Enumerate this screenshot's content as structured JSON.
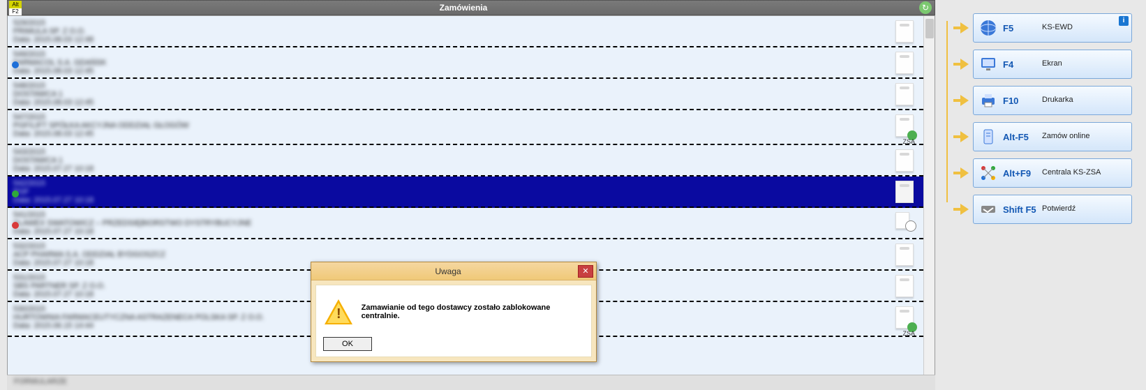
{
  "titlebar": {
    "alt_label": "Alt",
    "f2_label": "F2",
    "title": "Zamówienia"
  },
  "rows": [
    {
      "l1": "529/2015",
      "l2": "PRIMULA SP. Z O.O.",
      "l3": "Data: 2015.08.03 12:48",
      "icon": "doc"
    },
    {
      "l1": "549/2015",
      "l2": "FARMACOL S.A. GDAŃSK",
      "l3": "Data: 2015.08.03 12:45",
      "icon": "doc",
      "dot": "#1e6fd8"
    },
    {
      "l1": "548/2015",
      "l2": "DOSTAWCA 1",
      "l3": "Data: 2015.08.03 12:45",
      "icon": "doc"
    },
    {
      "l1": "547/2015",
      "l2": "PGF/LIFT SPÓŁKA AKCYJNA ODDZIAŁ GŁOGÓW",
      "l3": "Data: 2015.08.03 12:45",
      "icon": "zsa",
      "zsa": "ZSA"
    },
    {
      "l1": "543/2015",
      "l2": "DOSTAWCA 1",
      "l3": "Data: 2015.07.27 10:18",
      "icon": "doc"
    },
    {
      "l1": "542/2015",
      "l2": "PGF",
      "l3": "Data: 2015.07.27 10:18",
      "icon": "doc",
      "selected": true,
      "dot": "#2eaa3a"
    },
    {
      "l1": "541/2015",
      "l2": "SLAWEX SWATOWICZ – PRZEDSIĘBIORSTWO DYSTRYBUCYJNE",
      "l3": "Data: 2015.07.27 10:18",
      "icon": "clock",
      "dot": "#d83a3a"
    },
    {
      "l1": "532/2015",
      "l2": "ACP PHARMA S.A. ODDZIAŁ BYDGOSZCZ",
      "l3": "Data: 2015.07.27 10:18",
      "icon": "doc"
    },
    {
      "l1": "531/2015",
      "l2": "SBS PARTNER SP. Z O.O.",
      "l3": "Data: 2015.07.27 10:18",
      "icon": "doc"
    },
    {
      "l1": "530/2015",
      "l2": "HURTOWNIA FARMACEUTYCZNA ASTRAZENECA POLSKA SP. Z O.O.",
      "l3": "Data: 2015.06.15 14:44",
      "icon": "zsa",
      "zsa": "ZSA"
    }
  ],
  "bottom_strip": "FORMULARZE",
  "sidebar": {
    "buttons": [
      {
        "key": "F5",
        "label": "KS-EWD",
        "icon": "globe",
        "info": "i"
      },
      {
        "key": "F4",
        "label": "Ekran",
        "icon": "monitor"
      },
      {
        "key": "F10",
        "label": "Drukarka",
        "icon": "printer"
      },
      {
        "key": "Alt-F5",
        "label": "Zamów online",
        "icon": "online"
      },
      {
        "key": "Alt+F9",
        "label": "Centrala KS-ZSA",
        "icon": "nodes"
      },
      {
        "key": "Shift F5",
        "label": "Potwierdź",
        "icon": "handshake"
      }
    ]
  },
  "dialog": {
    "title": "Uwaga",
    "message": "Zamawianie od tego dostawcy zostało zablokowane centralnie.",
    "ok": "OK"
  }
}
